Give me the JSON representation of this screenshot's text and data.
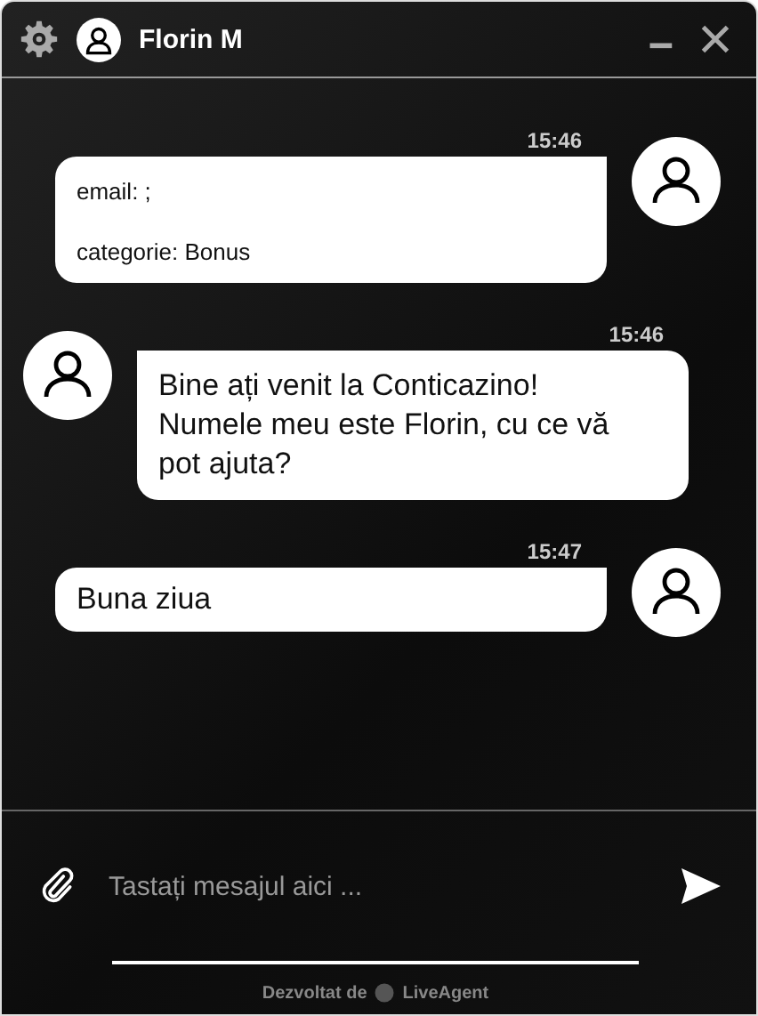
{
  "header": {
    "title": "Florin M"
  },
  "messages": [
    {
      "kind": "form",
      "time": "15:46",
      "lines": [
        "email: ;",
        "categorie: Bonus"
      ]
    },
    {
      "kind": "agent",
      "time": "15:46",
      "lines": [
        "Bine ați venit la Conticazino! Numele meu este Florin, cu ce vă pot ajuta?"
      ]
    },
    {
      "kind": "visitor",
      "time": "15:47",
      "lines": [
        "Buna ziua"
      ]
    }
  ],
  "composer": {
    "placeholder": "Tastați mesajul aici ..."
  },
  "footer": {
    "prefix": "Dezvoltat de",
    "brand": "LiveAgent"
  }
}
